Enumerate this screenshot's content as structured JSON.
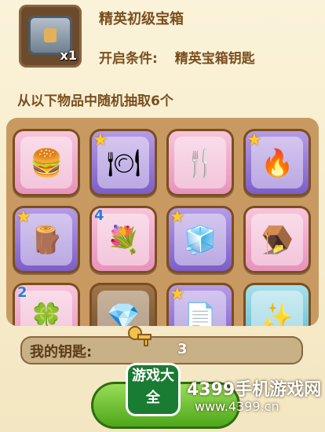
{
  "header": {
    "title": "精英初级宝箱",
    "condition_label": "开启条件:",
    "condition_value": "精英宝箱钥匙",
    "chest_qty": "x1"
  },
  "subtitle": "从以下物品中随机抽取6个",
  "items": [
    {
      "name": "burger",
      "bg": "pink",
      "badge": "",
      "glyph": "🍔"
    },
    {
      "name": "star-card-plate",
      "bg": "purple",
      "badge": "★",
      "glyph": "🍽"
    },
    {
      "name": "plate-fork",
      "bg": "pink",
      "badge": "",
      "glyph": "🍴"
    },
    {
      "name": "star-card-sun",
      "bg": "purple",
      "badge": "★",
      "glyph": "🔥"
    },
    {
      "name": "star-card-log",
      "bg": "purple",
      "badge": "★",
      "glyph": "🪵"
    },
    {
      "name": "flower-4",
      "bg": "pink",
      "badge": "4",
      "glyph": "💐"
    },
    {
      "name": "star-card-ice",
      "bg": "purple",
      "badge": "★",
      "glyph": "🧊"
    },
    {
      "name": "trap",
      "bg": "pink",
      "badge": "",
      "glyph": "🪤"
    },
    {
      "name": "clover-2",
      "bg": "pink",
      "badge": "2",
      "glyph": "🍀"
    },
    {
      "name": "crystal",
      "bg": "brown",
      "badge": "",
      "glyph": "💎"
    },
    {
      "name": "star-card-blank",
      "bg": "purple",
      "badge": "★",
      "glyph": "📄"
    },
    {
      "name": "charm",
      "bg": "teal",
      "badge": "",
      "glyph": "✨"
    }
  ],
  "keys": {
    "label": "我的钥匙:",
    "value": "3"
  },
  "watermark": {
    "logo": "游戏大全",
    "site": "4399手机游戏网",
    "url": "www.4399.cn"
  }
}
